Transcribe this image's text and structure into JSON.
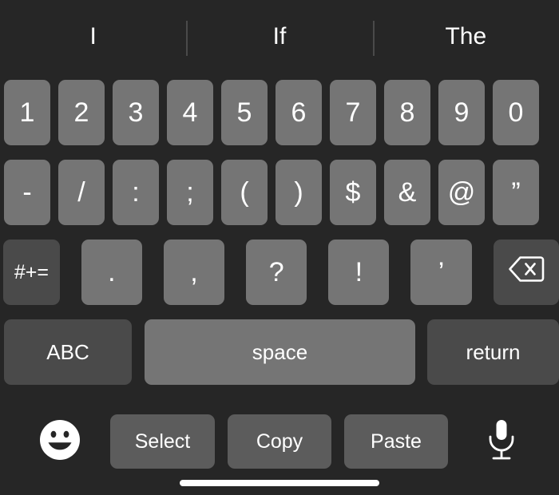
{
  "theme": {
    "background": "#262626",
    "key_light": "#757575",
    "key_dark": "#4a4a4a",
    "toolbar_button": "#5c5c5c",
    "text": "#ffffff",
    "divider": "#4a4a4a",
    "home_indicator": "#ffffff"
  },
  "predictive_bar": {
    "suggestions": [
      {
        "label": "I"
      },
      {
        "label": "If"
      },
      {
        "label": "The"
      }
    ]
  },
  "rows": {
    "numbers": [
      {
        "label": "1"
      },
      {
        "label": "2"
      },
      {
        "label": "3"
      },
      {
        "label": "4"
      },
      {
        "label": "5"
      },
      {
        "label": "6"
      },
      {
        "label": "7"
      },
      {
        "label": "8"
      },
      {
        "label": "9"
      },
      {
        "label": "0"
      }
    ],
    "symbols": [
      {
        "label": "-"
      },
      {
        "label": "/"
      },
      {
        "label": ":"
      },
      {
        "label": ";"
      },
      {
        "label": "("
      },
      {
        "label": ")"
      },
      {
        "label": "$"
      },
      {
        "label": "&"
      },
      {
        "label": "@"
      },
      {
        "label": "”"
      }
    ],
    "extra": {
      "shift_label": "#+=",
      "chars": [
        {
          "label": "."
        },
        {
          "label": ","
        },
        {
          "label": "?"
        },
        {
          "label": "!"
        },
        {
          "label": "’"
        }
      ],
      "backspace_icon": "backspace-icon"
    },
    "bottom": {
      "abc_label": "ABC",
      "space_label": "space",
      "return_label": "return"
    }
  },
  "toolbar": {
    "emoji_icon": "smiley-face-icon",
    "buttons": [
      {
        "label": "Select"
      },
      {
        "label": "Copy"
      },
      {
        "label": "Paste"
      }
    ],
    "mic_icon": "microphone-icon"
  }
}
